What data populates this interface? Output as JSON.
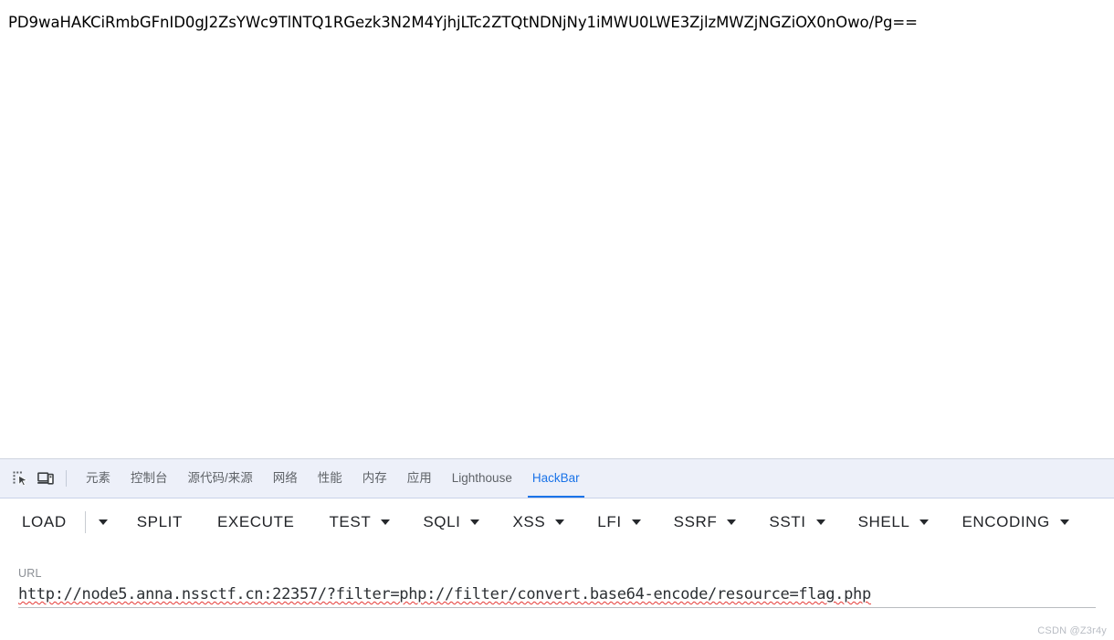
{
  "page": {
    "body_text": "PD9waHAKCiRmbGFnID0gJ2ZsYWc9TlNTQ1RGezk3N2M4YjhjLTc2ZTQtNDNjNy1iMWU0LWE3ZjlzMWZjNGZiOX0nOwo/Pg=="
  },
  "devtools": {
    "toolbar_icons": [
      {
        "name": "inspect-element-icon",
        "title": "Inspect"
      },
      {
        "name": "device-toolbar-icon",
        "title": "Toggle device toolbar"
      }
    ],
    "tabs": [
      {
        "label": "元素",
        "id": "elements",
        "active": false
      },
      {
        "label": "控制台",
        "id": "console",
        "active": false
      },
      {
        "label": "源代码/来源",
        "id": "sources",
        "active": false
      },
      {
        "label": "网络",
        "id": "network",
        "active": false
      },
      {
        "label": "性能",
        "id": "performance",
        "active": false
      },
      {
        "label": "内存",
        "id": "memory",
        "active": false
      },
      {
        "label": "应用",
        "id": "application",
        "active": false
      },
      {
        "label": "Lighthouse",
        "id": "lighthouse",
        "active": false
      },
      {
        "label": "HackBar",
        "id": "hackbar",
        "active": true
      }
    ],
    "active_tab": "HackBar",
    "accent_color": "#1a73e8",
    "tabbar_background": "#edf0f9"
  },
  "hackbar": {
    "buttons": [
      {
        "label": "LOAD",
        "has_caret": true,
        "caret_separated": true
      },
      {
        "label": "SPLIT",
        "has_caret": false
      },
      {
        "label": "EXECUTE",
        "has_caret": false
      },
      {
        "label": "TEST",
        "has_caret": true
      },
      {
        "label": "SQLI",
        "has_caret": true
      },
      {
        "label": "XSS",
        "has_caret": true
      },
      {
        "label": "LFI",
        "has_caret": true
      },
      {
        "label": "SSRF",
        "has_caret": true
      },
      {
        "label": "SSTI",
        "has_caret": true
      },
      {
        "label": "SHELL",
        "has_caret": true
      },
      {
        "label": "ENCODING",
        "has_caret": true
      }
    ],
    "url_field": {
      "label": "URL",
      "value": "http://node5.anna.nssctf.cn:22357/?filter=php://filter/convert.base64-encode/resource=flag.php",
      "placeholder": "URL"
    }
  },
  "watermark": {
    "text": "CSDN @Z3r4y"
  }
}
